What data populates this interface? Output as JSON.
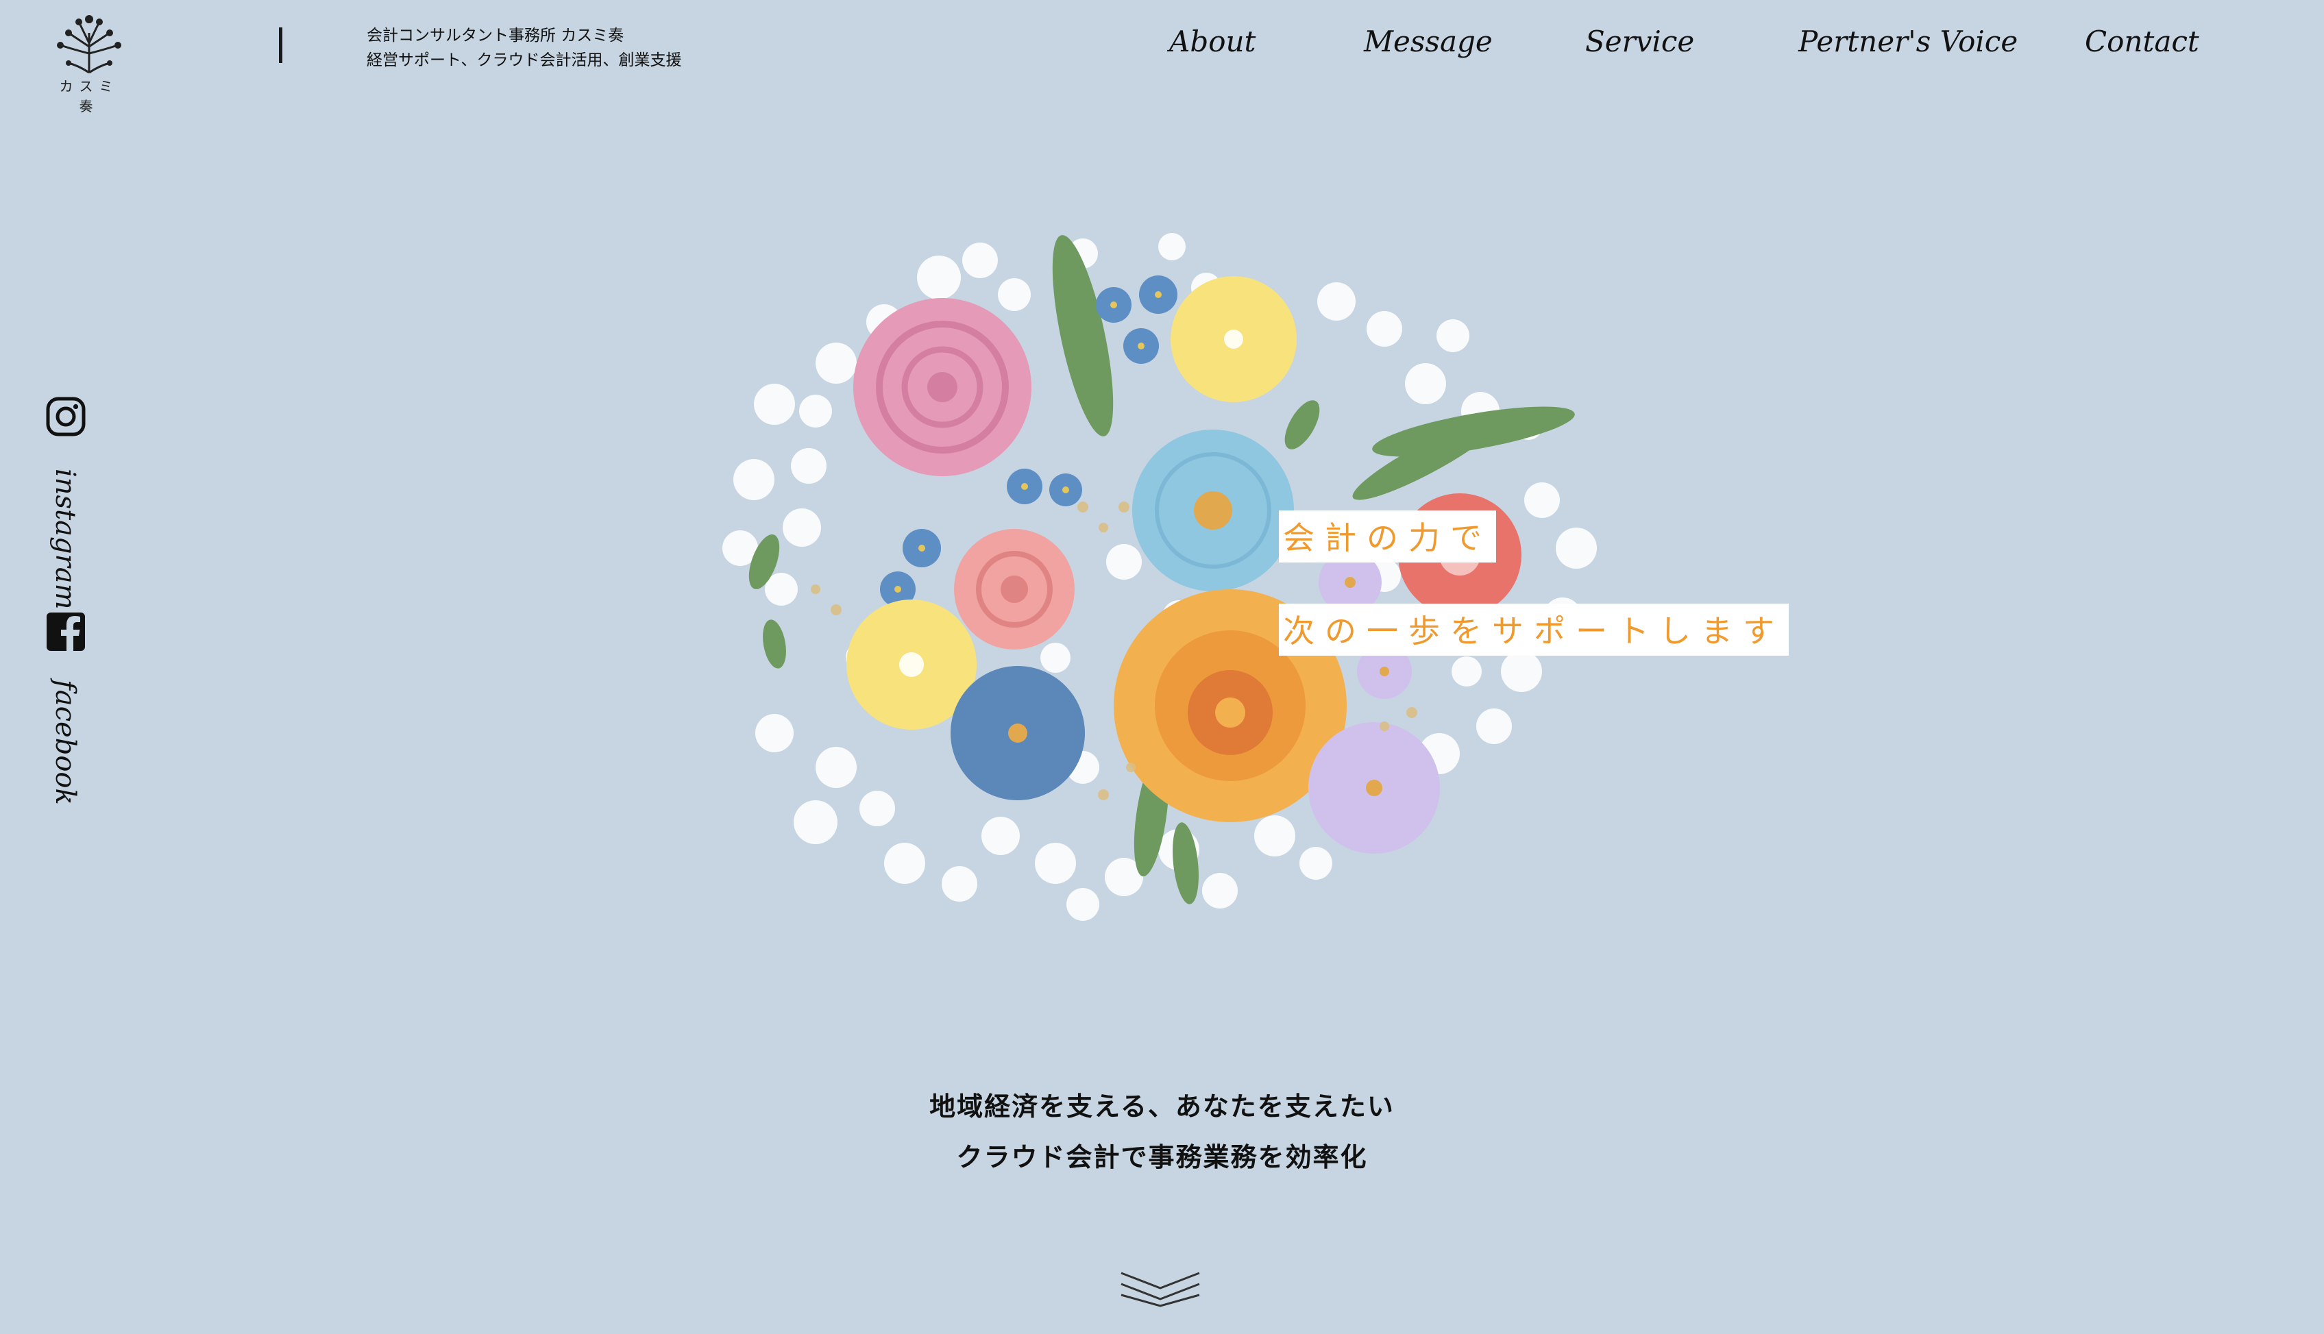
{
  "header": {
    "logo_text": "カスミ奏",
    "tagline_line1": "会計コンサルタント事務所 カスミ奏",
    "tagline_line2": "経営サポート、クラウド会計活用、創業支援"
  },
  "nav": {
    "items": [
      {
        "label": "About"
      },
      {
        "label": "Message"
      },
      {
        "label": "Service"
      },
      {
        "label": "Pertner's Voice"
      },
      {
        "label": "Contact"
      }
    ]
  },
  "social": {
    "instagram_label": "instagram",
    "facebook_label": "facebook",
    "instagram_icon": "instagram-icon",
    "facebook_icon": "facebook-icon"
  },
  "hero": {
    "line1": "会計の力で",
    "line2": "次の一歩をサポートします",
    "text_color": "#f09a2e"
  },
  "lead": {
    "line1": "地域経済を支える、あなたを支えたい",
    "line2": "クラウド会計で事務業務を効率化"
  },
  "colors": {
    "background": "#c6d5e1",
    "accent": "#f09a2e"
  }
}
